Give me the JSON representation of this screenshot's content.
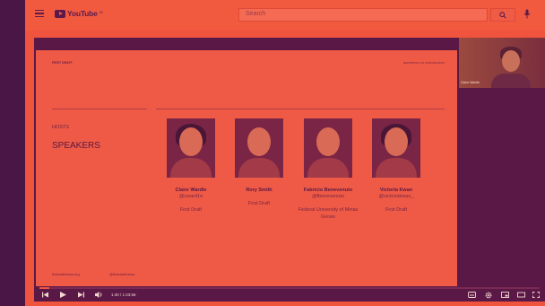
{
  "header": {
    "logo_text": "YouTube",
    "logo_superscript": "IN",
    "search_placeholder": "Search"
  },
  "slide": {
    "brand": "FIRST DRAFT",
    "brand_right": "REPORTING ON CORONAVIRUS",
    "hosts_label": "HOSTS",
    "speakers_label": "SPEAKERS",
    "speakers": [
      {
        "name": "Claire Wardle",
        "handle": "@cward1e",
        "org": "First Draft"
      },
      {
        "name": "Rory Smith",
        "handle": "",
        "org": "First Draft"
      },
      {
        "name": "Fabricio Benevenuto",
        "handle": "@fbenevenuto",
        "org": "Federal University of Minas Gerais"
      },
      {
        "name": "Victoria Kwan",
        "handle": "@victoriakwan_",
        "org": "First Draft"
      }
    ],
    "footer_site": "firstdraftnews.org",
    "footer_handle": "@firstdraftnews"
  },
  "webcam": {
    "label": "Claire Wardle"
  },
  "player": {
    "time": "1:30 / 1:23:56",
    "progress": 0.02
  },
  "colors": {
    "accent": "#f0543e",
    "frame": "#4a1646",
    "dark": "#5a1846"
  }
}
